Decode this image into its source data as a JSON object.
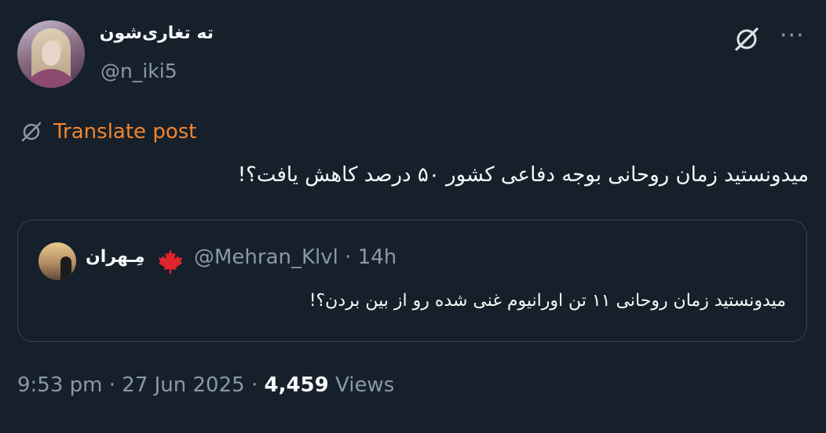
{
  "author": {
    "display_name": "ته تغاری‌شون",
    "handle": "@n_iki5"
  },
  "translate": {
    "label": "Translate post"
  },
  "tweet": {
    "text": "میدونستید زمان روحانی بوجه دفاعی کشور ۵۰ درصد کاهش یافت؟!"
  },
  "quote": {
    "name": "مِـهران",
    "handle_time": "@Mehran_Klvl · 14h",
    "text": "میدونستید زمان روحانی ۱۱ تن اورانیوم غنی شده  رو از بین بردن؟!"
  },
  "meta": {
    "time_date": "9:53 pm · 27 Jun 2025 · ",
    "views_count": "4,459",
    "views_label": " Views"
  },
  "colors": {
    "background": "#15202b",
    "text_primary": "#f7f9f9",
    "text_secondary": "#8b98a5",
    "link_orange": "#f4842d",
    "border": "#38444d",
    "maple_red": "#e0252c"
  },
  "icons": {
    "grok": "grok-icon",
    "more": "more-icon",
    "translate": "translate-icon",
    "flag": "maple-leaf-icon"
  }
}
